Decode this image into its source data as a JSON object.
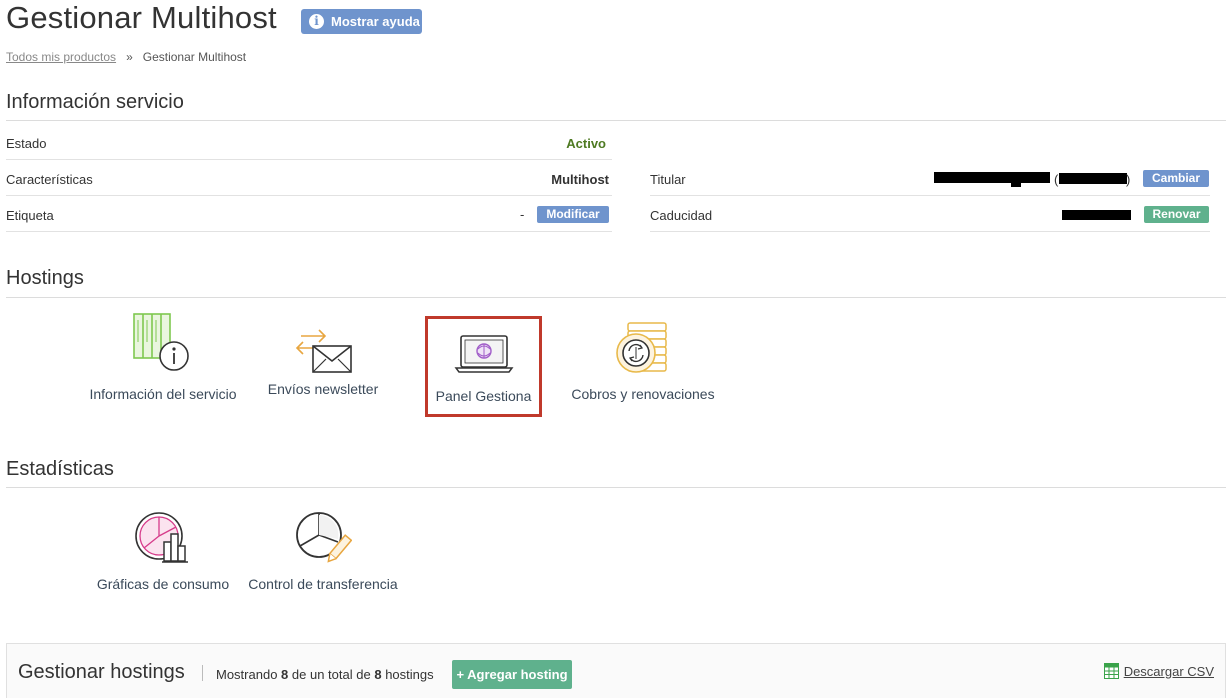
{
  "header": {
    "title": "Gestionar Multihost",
    "help_label": "Mostrar ayuda"
  },
  "breadcrumb": {
    "link": "Todos mis productos",
    "separator": "»",
    "current": "Gestionar Multihost"
  },
  "info": {
    "title": "Información servicio",
    "estado_label": "Estado",
    "estado_value": "Activo",
    "caracteristicas_label": "Características",
    "caracteristicas_value": "Multihost",
    "etiqueta_label": "Etiqueta",
    "etiqueta_value": "-",
    "modificar_label": "Modificar",
    "titular_label": "Titular",
    "titular_paren_open": "(",
    "titular_paren_close": ")",
    "cambiar_label": "Cambiar",
    "caducidad_label": "Caducidad",
    "renovar_label": "Renovar"
  },
  "hostings": {
    "title": "Hostings",
    "items": [
      {
        "label": "Información del servicio",
        "icon": "server-info-icon"
      },
      {
        "label": "Envíos newsletter",
        "icon": "newsletter-icon"
      },
      {
        "label": "Panel Gestiona",
        "icon": "laptop-panel-icon"
      },
      {
        "label": "Cobros y renovaciones",
        "icon": "billing-coins-icon"
      }
    ]
  },
  "stats": {
    "title": "Estadísticas",
    "items": [
      {
        "label": "Gráficas de consumo",
        "icon": "usage-charts-icon"
      },
      {
        "label": "Control de transferencia",
        "icon": "transfer-control-icon"
      }
    ]
  },
  "manage": {
    "title": "Gestionar hostings",
    "showing_prefix": "Mostrando",
    "shown_count": "8",
    "showing_middle": "de un total de",
    "total_count": "8",
    "showing_suffix": "hostings",
    "add_label": "+ Agregar hosting",
    "csv_label": "Descargar CSV"
  },
  "colors": {
    "accent_blue": "#6f94cd",
    "accent_green": "#5fb18d",
    "active_green": "#4e7a22",
    "highlight_red": "#c0392b"
  }
}
